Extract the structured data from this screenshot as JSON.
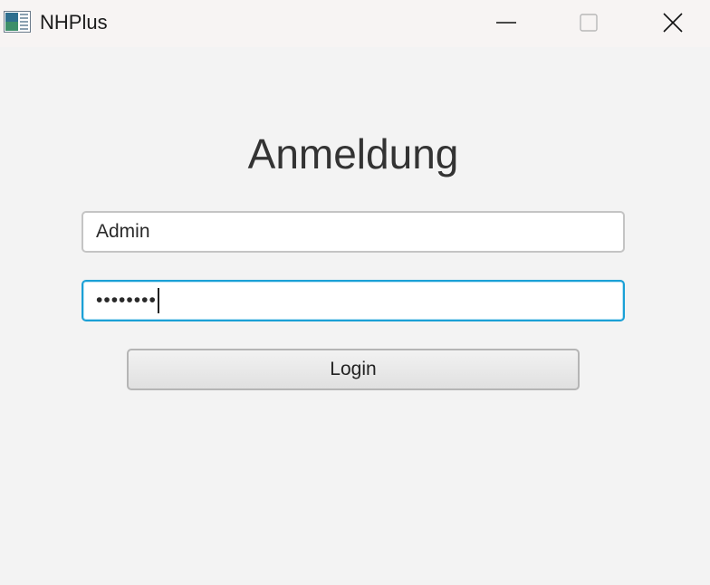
{
  "window": {
    "title": "NHPlus",
    "controls": {
      "minimize_icon": "minimize-icon",
      "maximize_icon": "maximize-icon",
      "close_icon": "close-icon"
    }
  },
  "login": {
    "heading": "Anmeldung",
    "username_value": "Admin",
    "password_value": "••••••••",
    "login_label": "Login"
  },
  "colors": {
    "background": "#f3f3f3",
    "focus_border": "#1ba0d6"
  }
}
